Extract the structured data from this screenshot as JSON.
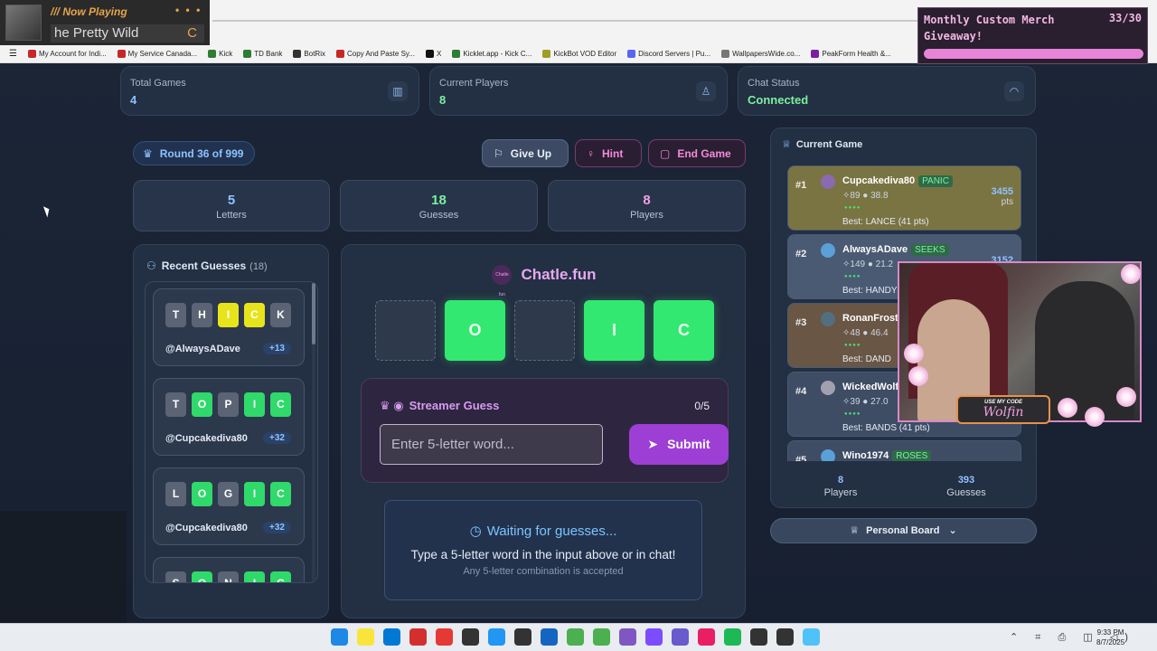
{
  "now_playing": {
    "label": "/// Now Playing",
    "dots": "• • •",
    "song": "he Pretty Wild"
  },
  "bookmarks": [
    {
      "label": "My Account for Indi...",
      "color": "#c62828"
    },
    {
      "label": "My Service Canada...",
      "color": "#c62828"
    },
    {
      "label": "Kick",
      "color": "#2e7d32"
    },
    {
      "label": "TD Bank",
      "color": "#2e7d32"
    },
    {
      "label": "BotRix",
      "color": "#333333"
    },
    {
      "label": "Copy And Paste Sy...",
      "color": "#c62828"
    },
    {
      "label": "X",
      "color": "#111111"
    },
    {
      "label": "Kicklet.app - Kick C...",
      "color": "#2e7d32"
    },
    {
      "label": "KickBot VOD Editor",
      "color": "#9e9d24"
    },
    {
      "label": "Discord Servers | Pu...",
      "color": "#5865f2"
    },
    {
      "label": "WallpapersWide.co...",
      "color": "#777777"
    },
    {
      "label": "PeakForm Health &...",
      "color": "#7b1fa2"
    }
  ],
  "merch": {
    "title": "Monthly Custom Merch Giveaway!",
    "count": "33/30",
    "progress": 1.0
  },
  "stats": [
    {
      "label": "Total Games",
      "value": "4",
      "icon": "bar-chart-icon",
      "glyph": "▥",
      "color": "#8fc2ff"
    },
    {
      "label": "Current Players",
      "value": "8",
      "icon": "user-icon",
      "glyph": "♙",
      "color": "#7bf0a0"
    },
    {
      "label": "Chat Status",
      "value": "Connected",
      "icon": "wifi-icon",
      "glyph": "◠",
      "color": "#7bf0a0"
    }
  ],
  "round": {
    "label": "Round 36 of 999",
    "glyph": "♛"
  },
  "buttons": {
    "give_up": "Give Up",
    "give_up_glyph": "⚐",
    "hint": "Hint",
    "hint_glyph": "♀",
    "end_game": "End Game",
    "end_glyph": "▢"
  },
  "mini_stats": [
    {
      "num": "5",
      "label": "Letters",
      "color": "#8fc2ff"
    },
    {
      "num": "18",
      "label": "Guesses",
      "color": "#7bf0a0"
    },
    {
      "num": "8",
      "label": "Players",
      "color": "#f0a0e8"
    }
  ],
  "recent": {
    "title": "Recent Guesses",
    "count": "(18)",
    "items": [
      {
        "tiles": [
          {
            "l": "T",
            "s": "gray"
          },
          {
            "l": "H",
            "s": "gray"
          },
          {
            "l": "I",
            "s": "yellow"
          },
          {
            "l": "C",
            "s": "yellow"
          },
          {
            "l": "K",
            "s": "gray"
          }
        ],
        "user": "@AlwaysADave",
        "pts": "+13"
      },
      {
        "tiles": [
          {
            "l": "T",
            "s": "gray"
          },
          {
            "l": "O",
            "s": "green"
          },
          {
            "l": "P",
            "s": "gray"
          },
          {
            "l": "I",
            "s": "green"
          },
          {
            "l": "C",
            "s": "green"
          }
        ],
        "user": "@Cupcakediva80",
        "pts": "+32"
      },
      {
        "tiles": [
          {
            "l": "L",
            "s": "gray"
          },
          {
            "l": "O",
            "s": "green"
          },
          {
            "l": "G",
            "s": "gray"
          },
          {
            "l": "I",
            "s": "green"
          },
          {
            "l": "C",
            "s": "green"
          }
        ],
        "user": "@Cupcakediva80",
        "pts": "+32"
      },
      {
        "tiles": [
          {
            "l": "S",
            "s": "gray"
          },
          {
            "l": "O",
            "s": "green"
          },
          {
            "l": "N",
            "s": "gray"
          },
          {
            "l": "I",
            "s": "green"
          },
          {
            "l": "C",
            "s": "green"
          }
        ],
        "user": "",
        "pts": ""
      }
    ]
  },
  "game": {
    "logo_badge": "Chatle fun",
    "logo_text": "Chatle.fun",
    "word": [
      {
        "l": "",
        "s": "empty"
      },
      {
        "l": "O",
        "s": "correct"
      },
      {
        "l": "",
        "s": "empty"
      },
      {
        "l": "I",
        "s": "correct"
      },
      {
        "l": "C",
        "s": "correct"
      }
    ],
    "streamer_title": "Streamer Guess",
    "streamer_glyph": "♛ ◉",
    "streamer_count": "0/5",
    "input_placeholder": "Enter 5-letter word...",
    "submit": "Submit",
    "submit_glyph": "➤",
    "waiting_title": "Waiting for guesses...",
    "waiting_glyph": "◷",
    "waiting_sub": "Type a 5-letter word in the input above or in chat!",
    "waiting_note": "Any 5-letter combination is accepted"
  },
  "current_game": {
    "title": "Current Game",
    "glyph": "♕",
    "players": [
      {
        "rank": "#1",
        "name": "Cupcakediva80",
        "word": "PANIC",
        "stats": "✧89 ● 38.8",
        "dots": "●●●●",
        "best": "Best: LANCE (41 pts)",
        "score": "3455",
        "pts": "pts",
        "bg": "#7a7442",
        "avatar": "#8a6ab0"
      },
      {
        "rank": "#2",
        "name": "AlwaysADave",
        "word": "SEEKS",
        "stats": "✧149 ● 21.2",
        "dots": "●●●●",
        "best": "Best: HANDY",
        "score": "3152",
        "pts": "",
        "bg": "#4a5a72",
        "avatar": "#5aa0d8"
      },
      {
        "rank": "#3",
        "name": "RonanFrost",
        "word": "",
        "stats": "✧48 ● 46.4",
        "dots": "●●●●",
        "best": "Best: DAND",
        "score": "",
        "pts": "",
        "bg": "#6a5644",
        "avatar": "#507080"
      },
      {
        "rank": "#4",
        "name": "WickedWolf",
        "word": "",
        "stats": "✧39 ● 27.0",
        "dots": "●●●●",
        "best": "Best: BANDS (41 pts)",
        "score": "",
        "pts": "",
        "bg": "#3e4c64",
        "avatar": "#a0a0b0"
      },
      {
        "rank": "#5",
        "name": "Wino1974",
        "word": "ROSES",
        "stats": "",
        "dots": "",
        "best": "",
        "score": "",
        "pts": "",
        "bg": "#3e4c64",
        "avatar": "#5aa0d8"
      }
    ],
    "footer": [
      {
        "n": "8",
        "l": "Players"
      },
      {
        "n": "393",
        "l": "Guesses"
      }
    ]
  },
  "personal_board": {
    "label": "Personal Board",
    "glyph": "♕",
    "chevron": "⌄"
  },
  "webcam": {
    "code_label": "USE MY CODE",
    "code": "Wolfin"
  },
  "taskbar": {
    "icons": [
      "#1e88e5",
      "#f9e43b",
      "#0078d4",
      "#d32f2f",
      "#e53935",
      "#333333",
      "#2196f3",
      "#333333",
      "#1565c0",
      "#4caf50",
      "#4caf50",
      "#7e57c2",
      "#7c4dff",
      "#6a5acd",
      "#e91e63",
      "#1db954",
      "#333333",
      "#333333",
      "#4fc3f7"
    ],
    "tray": "⌃ ⌗ ⎙ ◫ ◁)",
    "time": "9:33 PM",
    "date": "8/7/2025"
  }
}
